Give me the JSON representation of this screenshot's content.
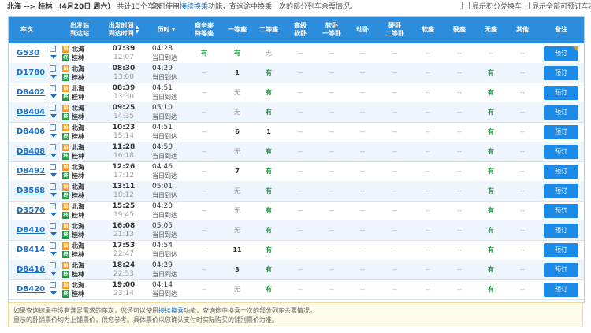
{
  "topbar": {
    "from": "北海",
    "arrow": "-->",
    "to": "桂林",
    "date": "（4月20日 周六）",
    "total": "共计13个车次",
    "notice_pre": "您可使用",
    "notice_link": "接续换乘",
    "notice_post": "功能，查询途中换乘一次的部分列车余票情况。",
    "opt_points": "显示积分兑换车次",
    "opt_all": "显示全部可预订车次"
  },
  "header": {
    "train": "车次",
    "station_a": "出发站",
    "station_b": "到达站",
    "time_a": "出发时间",
    "time_b": "到达时间",
    "duration": "历时",
    "business_a": "商务座",
    "business_b": "特等座",
    "first": "一等座",
    "second": "二等座",
    "softsleeper_a": "高级",
    "softsleeper_b": "软卧",
    "soft_a": "软卧",
    "soft_b": "一等卧",
    "move": "动卧",
    "hard_a": "硬卧",
    "hard_b": "二等卧",
    "softseat": "软座",
    "hardseat": "硬座",
    "noseat": "无座",
    "other": "其他",
    "note": "备注"
  },
  "rows": [
    {
      "train": "G530",
      "from": "北海",
      "to": "桂林",
      "dep": "07:39",
      "arr": "12:07",
      "dur": "04:28",
      "day": "当日到达",
      "seats": [
        "有",
        "有",
        "无",
        "--",
        "--",
        "--",
        "--",
        "--",
        "--",
        "--",
        "--"
      ],
      "book": "预订",
      "flag": true
    },
    {
      "train": "D1780",
      "from": "北海",
      "to": "桂林",
      "dep": "08:30",
      "arr": "13:00",
      "dur": "04:29",
      "day": "当日到达",
      "seats": [
        "--",
        "1",
        "有",
        "--",
        "--",
        "--",
        "--",
        "--",
        "--",
        "有",
        "--"
      ],
      "book": "预订",
      "flag": false
    },
    {
      "train": "D8402",
      "from": "北海",
      "to": "桂林",
      "dep": "08:39",
      "arr": "13:30",
      "dur": "04:51",
      "day": "当日到达",
      "seats": [
        "--",
        "无",
        "有",
        "--",
        "--",
        "--",
        "--",
        "--",
        "--",
        "有",
        "--"
      ],
      "book": "预订",
      "flag": false
    },
    {
      "train": "D8404",
      "from": "北海",
      "to": "桂林",
      "dep": "09:25",
      "arr": "14:35",
      "dur": "05:10",
      "day": "当日到达",
      "seats": [
        "--",
        "无",
        "有",
        "--",
        "--",
        "--",
        "--",
        "--",
        "--",
        "有",
        "--"
      ],
      "book": "预订",
      "flag": false
    },
    {
      "train": "D8406",
      "from": "北海",
      "to": "桂林",
      "dep": "10:23",
      "arr": "15:14",
      "dur": "04:51",
      "day": "当日到达",
      "seats": [
        "--",
        "6",
        "1",
        "--",
        "--",
        "--",
        "--",
        "--",
        "--",
        "有",
        "--"
      ],
      "book": "预订",
      "flag": false
    },
    {
      "train": "D8408",
      "from": "北海",
      "to": "桂林",
      "dep": "11:28",
      "arr": "16:18",
      "dur": "04:50",
      "day": "当日到达",
      "seats": [
        "--",
        "无",
        "有",
        "--",
        "--",
        "--",
        "--",
        "--",
        "--",
        "有",
        "--"
      ],
      "book": "预订",
      "flag": false
    },
    {
      "train": "D8492",
      "from": "北海",
      "to": "桂林",
      "dep": "12:26",
      "arr": "17:12",
      "dur": "04:46",
      "day": "当日到达",
      "seats": [
        "--",
        "7",
        "有",
        "--",
        "--",
        "--",
        "--",
        "--",
        "--",
        "有",
        "--"
      ],
      "book": "预订",
      "flag": false
    },
    {
      "train": "D3568",
      "from": "北海",
      "to": "桂林",
      "dep": "13:11",
      "arr": "18:12",
      "dur": "05:01",
      "day": "当日到达",
      "seats": [
        "--",
        "无",
        "有",
        "--",
        "--",
        "--",
        "--",
        "--",
        "--",
        "有",
        "--"
      ],
      "book": "预订",
      "flag": false
    },
    {
      "train": "D3570",
      "from": "北海",
      "to": "桂林",
      "dep": "15:25",
      "arr": "19:45",
      "dur": "04:20",
      "day": "当日到达",
      "seats": [
        "--",
        "无",
        "有",
        "--",
        "--",
        "--",
        "--",
        "--",
        "--",
        "有",
        "--"
      ],
      "book": "预订",
      "flag": false
    },
    {
      "train": "D8410",
      "from": "北海",
      "to": "桂林",
      "dep": "16:08",
      "arr": "21:13",
      "dur": "05:05",
      "day": "当日到达",
      "seats": [
        "--",
        "无",
        "有",
        "--",
        "--",
        "--",
        "--",
        "--",
        "--",
        "有",
        "--"
      ],
      "book": "预订",
      "flag": false
    },
    {
      "train": "D8414",
      "from": "北海",
      "to": "桂林",
      "dep": "17:53",
      "arr": "22:47",
      "dur": "04:54",
      "day": "当日到达",
      "seats": [
        "--",
        "11",
        "有",
        "--",
        "--",
        "--",
        "--",
        "--",
        "--",
        "有",
        "--"
      ],
      "book": "预订",
      "flag": false
    },
    {
      "train": "D8416",
      "from": "北海",
      "to": "桂林",
      "dep": "18:24",
      "arr": "22:53",
      "dur": "04:29",
      "day": "当日到达",
      "seats": [
        "--",
        "3",
        "有",
        "--",
        "--",
        "--",
        "--",
        "--",
        "--",
        "有",
        "--"
      ],
      "book": "预订",
      "flag": false
    },
    {
      "train": "D8420",
      "from": "北海",
      "to": "桂林",
      "dep": "19:00",
      "arr": "23:14",
      "dur": "04:14",
      "day": "当日到达",
      "seats": [
        "--",
        "无",
        "有",
        "--",
        "--",
        "--",
        "--",
        "--",
        "--",
        "有",
        "--"
      ],
      "book": "预订",
      "flag": false
    }
  ],
  "badges": {
    "start": "始",
    "end": "终"
  },
  "footer": {
    "line1_pre": "如果查询结果中没有满足需求的车次，您还可以使用",
    "line1_link": "接续换乘",
    "line1_post": "功能，查询途中换乘一次的部分列车余票情况。",
    "line2": "显示的卧铺票价均为上铺票价，供您参考。具体票价以您确认支付时实际购买的铺别票价为准。"
  },
  "colors": {
    "header_bg": "#2c8ddc",
    "accent": "#1a70c3",
    "available": "#1e9b41",
    "button": "#1a8ae6"
  }
}
